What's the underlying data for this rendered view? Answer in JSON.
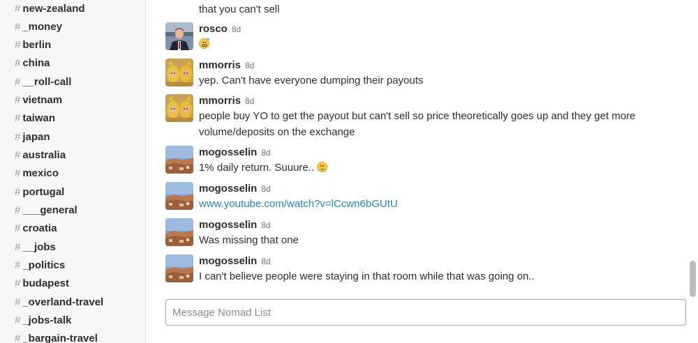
{
  "sidebar": {
    "hash": "#",
    "channels": [
      {
        "name": "new-zealand"
      },
      {
        "name": "_money"
      },
      {
        "name": "berlin"
      },
      {
        "name": "china"
      },
      {
        "name": "__roll-call"
      },
      {
        "name": "vietnam"
      },
      {
        "name": "taiwan"
      },
      {
        "name": "japan"
      },
      {
        "name": "australia"
      },
      {
        "name": "mexico"
      },
      {
        "name": "portugal"
      },
      {
        "name": "___general"
      },
      {
        "name": "croatia"
      },
      {
        "name": "__jobs"
      },
      {
        "name": "_politics"
      },
      {
        "name": "budapest"
      },
      {
        "name": "_overland-travel"
      },
      {
        "name": "_jobs-talk"
      },
      {
        "name": "_bargain-travel"
      }
    ]
  },
  "messages": {
    "continuation": "that you can't sell",
    "items": [
      {
        "author": "rosco",
        "time": "8d",
        "text": "",
        "emoji": "sweat-smile-icon",
        "avatar": "avatar-rosco"
      },
      {
        "author": "mmorris",
        "time": "8d",
        "text": "yep. Can't have everyone dumping their payouts",
        "avatar": "avatar-mmorris"
      },
      {
        "author": "mmorris",
        "time": "8d",
        "text": "people buy YO to get the payout but can't sell so price theoretically goes up and they get more volume/deposits on the exchange",
        "avatar": "avatar-mmorris"
      },
      {
        "author": "mogosselin",
        "time": "8d",
        "text": "1% daily return. Suuure.. ",
        "emoji": "smile-icon",
        "avatar": "avatar-mogosselin"
      },
      {
        "author": "mogosselin",
        "time": "8d",
        "link": "www.youtube.com/watch?v=lCcwn6bGUtU",
        "avatar": "avatar-mogosselin"
      },
      {
        "author": "mogosselin",
        "time": "8d",
        "text": "Was missing that one",
        "avatar": "avatar-mogosselin"
      },
      {
        "author": "mogosselin",
        "time": "8d",
        "text": "I can't believe people were staying in that room while that was going on..",
        "avatar": "avatar-mogosselin"
      }
    ]
  },
  "composer": {
    "placeholder": "Message Nomad List",
    "value": ""
  },
  "colors": {
    "link": "#2a80b9",
    "sidebar_bg": "#f7f7f7",
    "text": "#2c2d30"
  }
}
